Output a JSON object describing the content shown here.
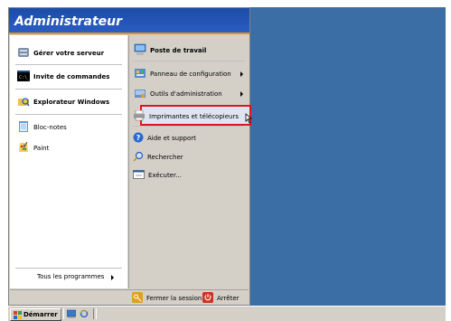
{
  "start_menu": {
    "user": "Administrateur",
    "left_items": [
      {
        "label": "Gérer votre serveur",
        "icon": "server-icon"
      },
      {
        "label": "Invite de commandes",
        "icon": "command-prompt-icon"
      },
      {
        "label": "Explorateur Windows",
        "icon": "explorer-icon"
      },
      {
        "label": "Bloc-notes",
        "icon": "notepad-icon"
      },
      {
        "label": "Paint",
        "icon": "paint-icon"
      }
    ],
    "all_programs_label": "Tous les programmes",
    "right_items": [
      {
        "label": "Poste de travail",
        "icon": "computer-icon"
      },
      {
        "label": "Panneau de configuration",
        "icon": "control-panel-icon"
      },
      {
        "label": "Outils d'administration",
        "icon": "admin-tools-icon"
      },
      {
        "label": "Imprimantes et télécopieurs",
        "icon": "printer-icon"
      },
      {
        "label": "Aide et support",
        "icon": "help-icon"
      },
      {
        "label": "Rechercher",
        "icon": "search-icon"
      },
      {
        "label": "Exécuter...",
        "icon": "run-icon"
      }
    ],
    "logoff_label": "Fermer la session",
    "shutdown_label": "Arrêter"
  },
  "taskbar": {
    "start_label": "Démarrer"
  },
  "colors": {
    "desktop": "#3a6ea5",
    "menu_header": "#1c4ca8",
    "highlight_border": "#e0141c"
  }
}
